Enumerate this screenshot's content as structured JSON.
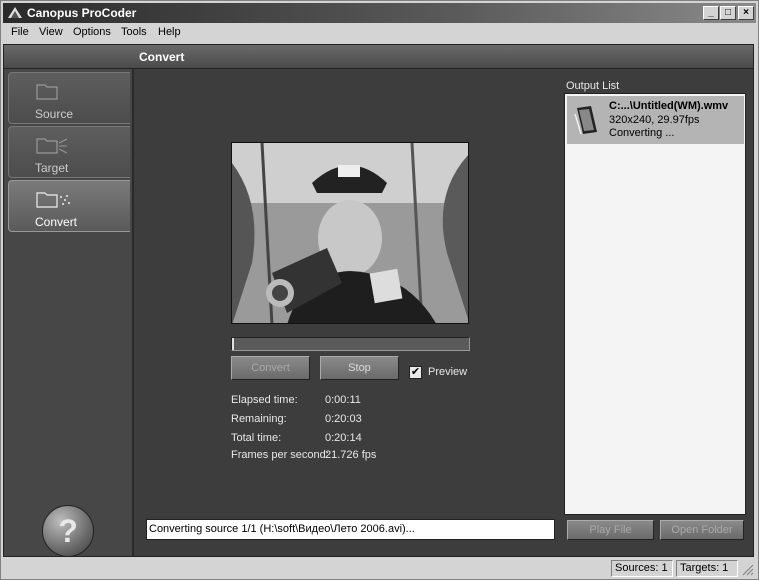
{
  "window": {
    "title": "Canopus ProCoder"
  },
  "menu": {
    "file": "File",
    "view": "View",
    "options": "Options",
    "tools": "Tools",
    "help": "Help"
  },
  "header": {
    "title": "Convert"
  },
  "sidebar": {
    "tabs": [
      {
        "label": "Source",
        "icon": "folder-icon"
      },
      {
        "label": "Target",
        "icon": "folder-target-icon"
      },
      {
        "label": "Convert",
        "icon": "folder-convert-icon",
        "active": true
      }
    ],
    "help_label": "?"
  },
  "controls": {
    "convert_label": "Convert",
    "stop_label": "Stop",
    "preview_label": "Preview",
    "preview_checked": true,
    "progress_fraction": 0.01
  },
  "stats": {
    "elapsed_label": "Elapsed time:",
    "elapsed_value": "0:00:11",
    "remaining_label": "Remaining:",
    "remaining_value": "0:20:03",
    "total_label": "Total time:",
    "total_value": "0:20:14",
    "fps_label": "Frames per second:",
    "fps_value": "21.726 fps"
  },
  "status_message": "Converting source 1/1 (H:\\soft\\Видео\\Лето 2006.avi)...",
  "output": {
    "label": "Output List",
    "items": [
      {
        "title": "C:...\\Untitled(WM).wmv",
        "info": "320x240, 29.97fps",
        "status": "Converting ..."
      }
    ],
    "play_label": "Play File",
    "open_label": "Open Folder"
  },
  "statusbar": {
    "sources": "Sources: 1",
    "targets": "Targets: 1"
  }
}
